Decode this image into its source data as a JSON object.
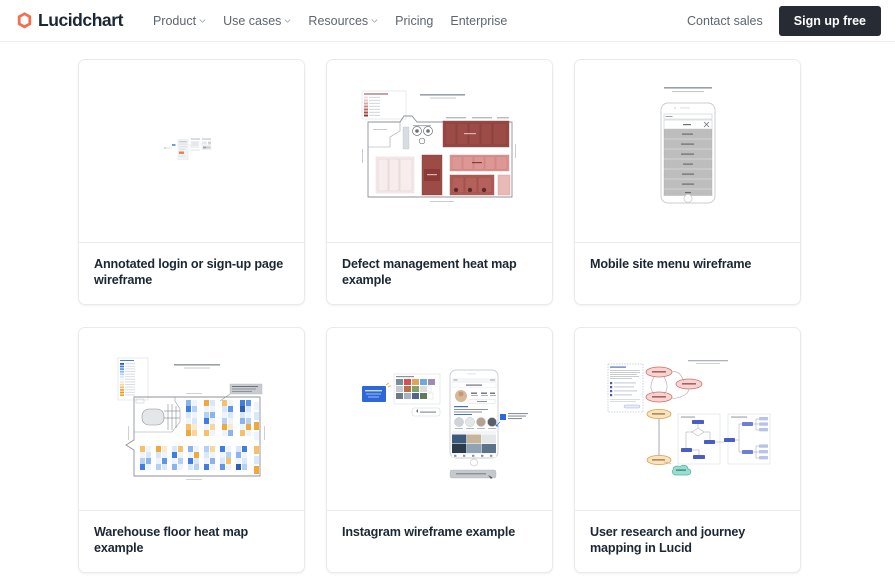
{
  "nav": {
    "logo_text": "Lucidchart",
    "logo_icon": "lucid-cube-icon",
    "logo_color": "#f2704e",
    "links": [
      {
        "label": "Product",
        "has_chevron": true,
        "icon": "chevron-down-icon"
      },
      {
        "label": "Use cases",
        "has_chevron": true,
        "icon": "chevron-down-icon"
      },
      {
        "label": "Resources",
        "has_chevron": true,
        "icon": "chevron-down-icon"
      },
      {
        "label": "Pricing",
        "has_chevron": false,
        "icon": ""
      },
      {
        "label": "Enterprise",
        "has_chevron": false,
        "icon": ""
      }
    ],
    "contact_sales_label": "Contact sales",
    "signup_label": "Sign up free",
    "signup_bg": "#272b33"
  },
  "gallery": {
    "cards": [
      {
        "title": "Annotated login or sign-up page wireframe",
        "thumb": "annotated-login-wireframe-thumbnail",
        "accent": "#4a7fd4"
      },
      {
        "title": "Defect management heat map example",
        "thumb": "defect-heat-map-floorplan-thumbnail",
        "accent": "#a24a45"
      },
      {
        "title": "Mobile site menu wireframe",
        "thumb": "mobile-phone-menu-wireframe-thumbnail",
        "accent": "#b9b9b9"
      },
      {
        "title": "Warehouse floor heat map example",
        "thumb": "warehouse-floor-heat-map-thumbnail",
        "accent": "#3d7ee0"
      },
      {
        "title": "Instagram wireframe example",
        "thumb": "instagram-wireframe-thumbnail",
        "accent": "#2d68d8"
      },
      {
        "title": "User research and journey mapping in Lucid",
        "thumb": "user-research-journey-map-thumbnail",
        "accent": "#e08a86"
      }
    ]
  }
}
